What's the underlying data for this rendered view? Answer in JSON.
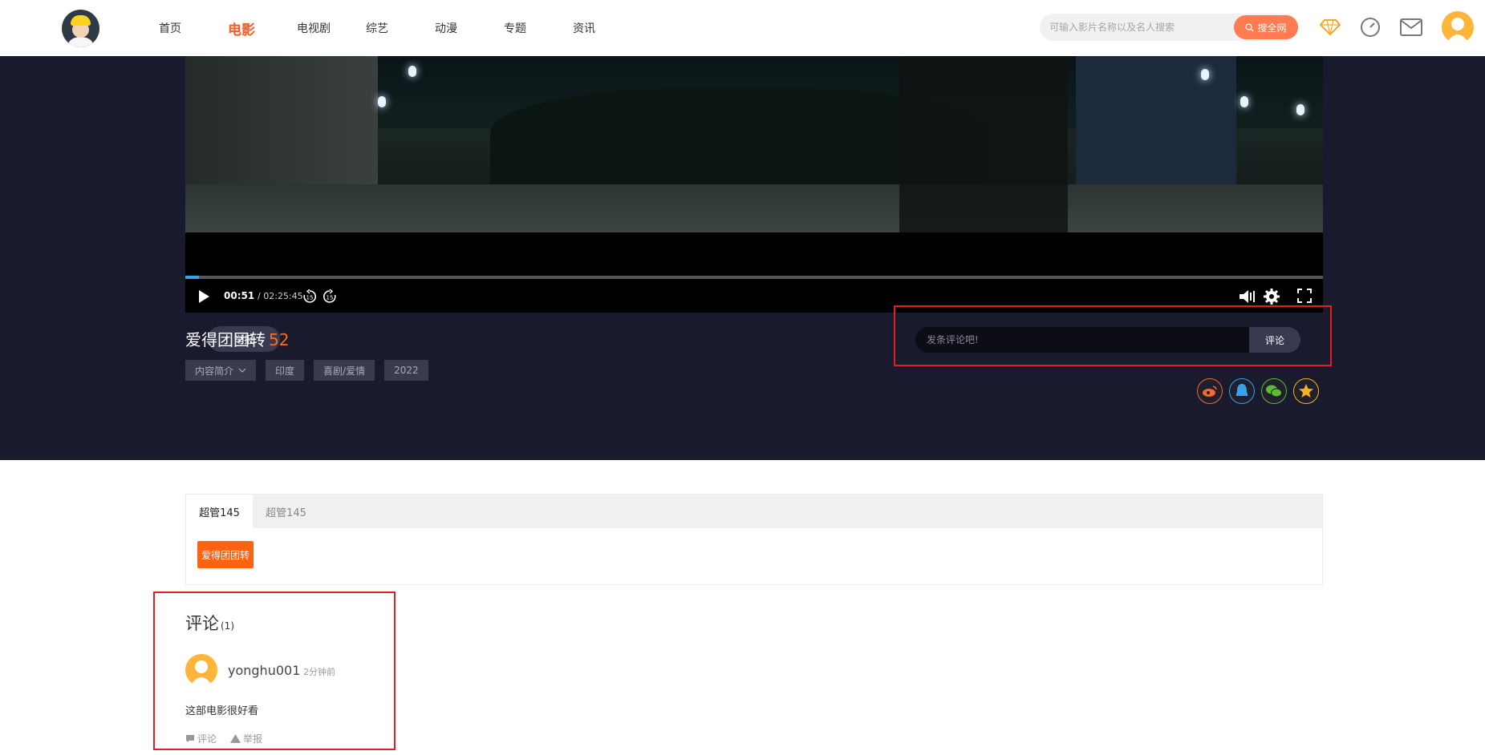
{
  "header": {
    "nav": [
      "首页",
      "电影",
      "电视剧",
      "综艺",
      "动漫",
      "专题",
      "资讯"
    ],
    "active_nav": "电影",
    "search_placeholder": "可输入影片名称以及名人搜索",
    "search_button": "搜全网",
    "icons": [
      "vip-diamond-icon",
      "history-clock-icon",
      "message-mail-icon",
      "user-avatar"
    ]
  },
  "player": {
    "current_time": "00:51",
    "total_time": "02:25:45",
    "progress_fraction": 0.0058,
    "report_button": "举报",
    "comment_placeholder": "发条评论吧!",
    "comment_button": "评论"
  },
  "movie": {
    "title": "爱得团团转",
    "score": "52",
    "tags": [
      "内容简介",
      "印度",
      "喜剧/爱情",
      "2022"
    ],
    "share_icons": [
      "weibo-icon",
      "qq-icon",
      "wechat-icon",
      "favorite-star-icon"
    ]
  },
  "episodes": {
    "tabs": [
      "超管145",
      "超管145"
    ],
    "items": [
      "爱得团团转"
    ]
  },
  "comments": {
    "title": "评论",
    "count": "(1)",
    "list": [
      {
        "user": "yonghu001",
        "time": "2分钟前",
        "text": "这部电影很好看",
        "reply": "评论",
        "report": "举报"
      }
    ]
  },
  "colors": {
    "accent": "#ff5a21",
    "dark_bg": "#191a2d",
    "highlight_border": "#e02020"
  }
}
